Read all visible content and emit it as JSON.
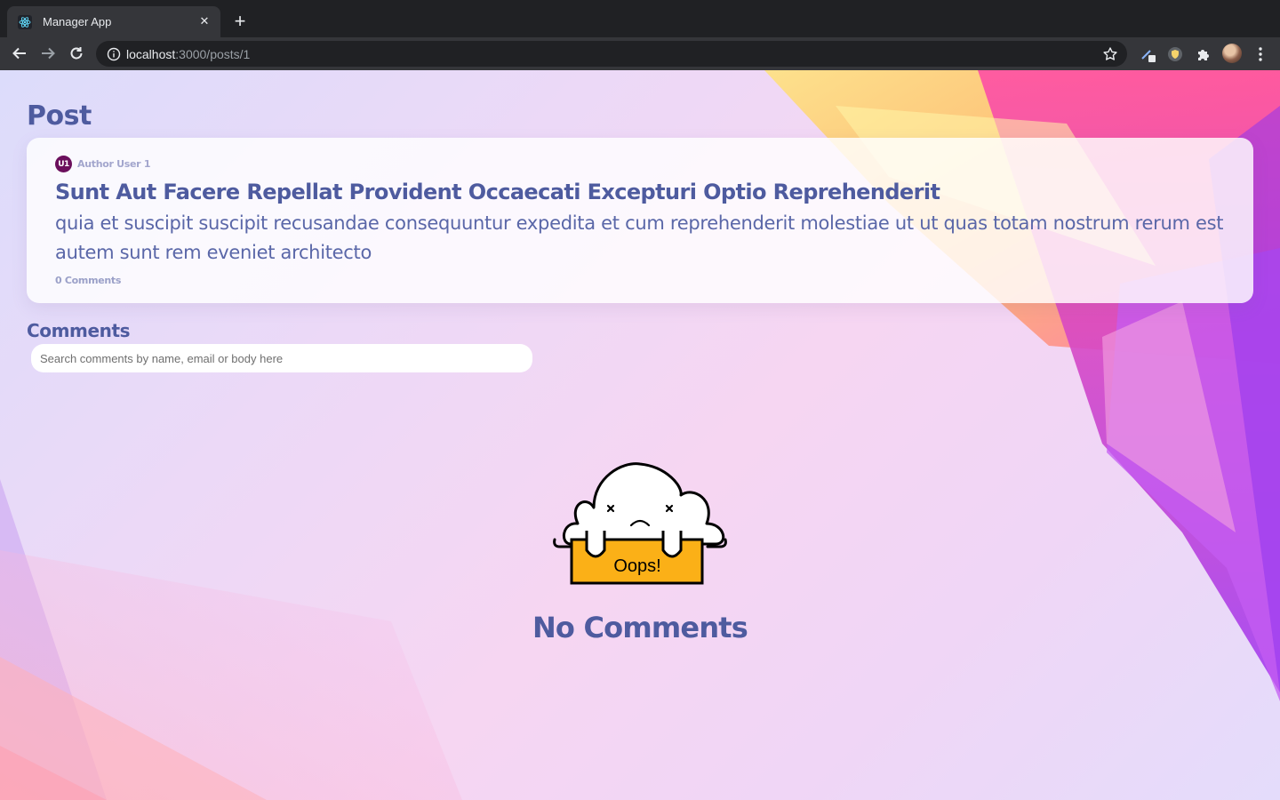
{
  "browser": {
    "tab_title": "Manager App",
    "url_host": "localhost",
    "url_path": ":3000/posts/1"
  },
  "page": {
    "heading": "Post",
    "post": {
      "author_initials": "U1",
      "author_name": "Author User 1",
      "title": "Sunt Aut Facere Repellat Provident Occaecati Excepturi Optio Reprehenderit",
      "body": "quia et suscipit suscipit recusandae consequuntur expedita et cum reprehenderit molestiae ut ut quas totam nostrum rerum est autem sunt rem eveniet architecto",
      "comments_label": "0 Comments"
    },
    "comments": {
      "heading": "Comments",
      "search_placeholder": "Search comments by name, email or body here",
      "search_value": "",
      "empty_sign_text": "Oops!",
      "empty_title": "No Comments"
    }
  },
  "colors": {
    "heading": "#4e5b9f",
    "author_avatar": "#6b0f5c",
    "sign": "#fbb017"
  },
  "icons": [
    "react-favicon-icon",
    "close-icon",
    "plus-icon",
    "back-arrow-icon",
    "forward-arrow-icon",
    "reload-icon",
    "info-icon",
    "star-icon",
    "pen-extension-icon",
    "shield-extension-icon",
    "puzzle-icon",
    "profile-avatar",
    "kebab-menu-icon"
  ]
}
